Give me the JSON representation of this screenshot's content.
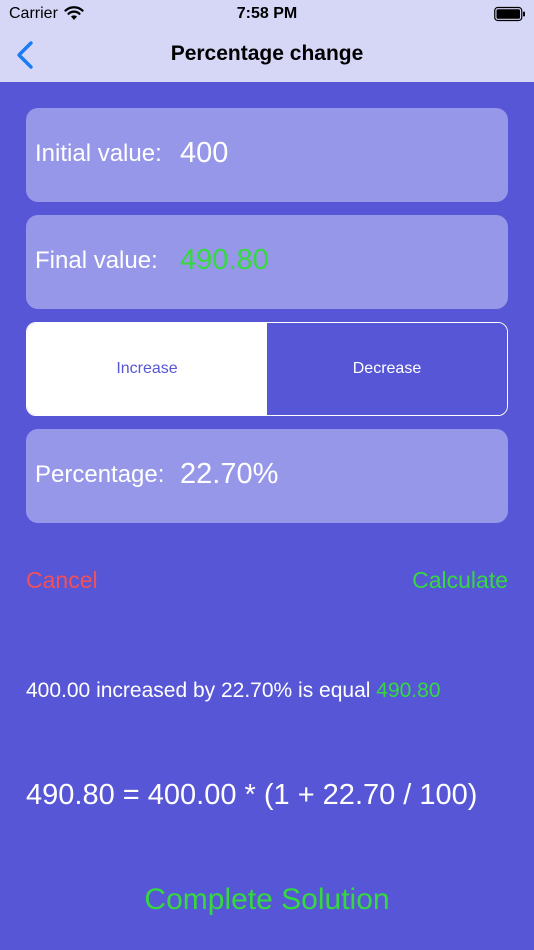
{
  "status_bar": {
    "carrier": "Carrier",
    "time": "7:58 PM",
    "wifi_icon": "wifi-icon",
    "battery_icon": "battery-full-icon"
  },
  "nav": {
    "title": "Percentage change",
    "back_icon": "chevron-left-icon"
  },
  "fields": {
    "initial_label": "Initial value:",
    "initial_value": "400",
    "final_label": "Final value:",
    "final_value": "490.80",
    "percentage_label": "Percentage:",
    "percentage_value": "22.70%"
  },
  "segmented": {
    "increase_label": "Increase",
    "decrease_label": "Decrease",
    "selected": "Increase"
  },
  "actions": {
    "cancel_label": "Cancel",
    "calculate_label": "Calculate",
    "complete_solution_label": "Complete Solution"
  },
  "result": {
    "sentence_prefix": "400.00 increased by 22.70% is equal",
    "sentence_value": "490.80",
    "formula": "490.80 = 400.00 * (1 + 22.70 / 100)"
  },
  "colors": {
    "background": "#5756d6",
    "bar": "#d6d6f7",
    "field": "#9797ea",
    "accent_green": "#35d93f",
    "accent_red": "#f05158",
    "back_blue": "#1a7cf5"
  }
}
